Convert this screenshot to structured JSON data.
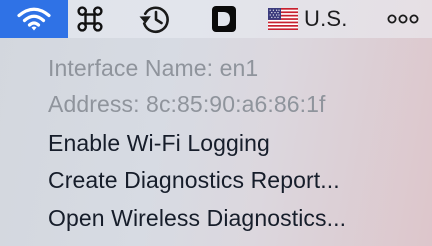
{
  "menubar": {
    "wifi_icon": "wifi-icon",
    "command_icon": "command-key-icon",
    "time_machine_icon": "time-machine-icon",
    "d_app_icon": "d-app-icon",
    "input_source": {
      "flag_icon": "us-flag-icon",
      "label": "U.S."
    },
    "more_icon": "more-dots-icon",
    "colors": {
      "wifi_highlight": "#2f72e6"
    }
  },
  "wifi_menu": {
    "interface_name": "Interface Name: en1",
    "address": "Address: 8c:85:90:a6:86:1f",
    "items": [
      {
        "label": "Enable Wi-Fi Logging"
      },
      {
        "label": "Create Diagnostics Report..."
      },
      {
        "label": "Open Wireless Diagnostics..."
      }
    ]
  }
}
